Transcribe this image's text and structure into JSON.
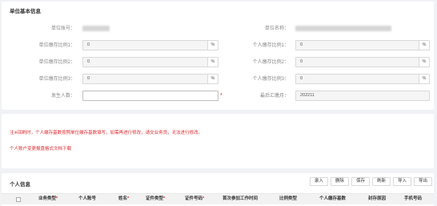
{
  "basic": {
    "title": "单位基本信息",
    "unit_no_label": "单位账号：",
    "unit_name_label": "单位名称：",
    "rows": [
      {
        "left_label": "单位缴存比例1：",
        "left_value": "0",
        "right_label": "个人缴存比例1：",
        "right_value": "0",
        "unit": "%"
      },
      {
        "left_label": "单位缴存比例2：",
        "left_value": "0",
        "right_label": "个人缴存比例2：",
        "right_value": "0",
        "unit": "%"
      },
      {
        "left_label": "单位缴存比例3：",
        "left_value": "0",
        "right_label": "个人缴存比例3：",
        "right_value": "0",
        "unit": "%"
      }
    ],
    "headcount_label": "发生人数：",
    "headcount_value": "",
    "required_mark": "*",
    "last_remit_label": "最后汇缴月：",
    "last_remit_value": "202211"
  },
  "notice": {
    "line1": "注※回刷时，个人缴存基数按照单位缴存基数填写，如需再进行修改，请交业务员，无法进行修改。",
    "line2": "个人账户变更报盘格式文档下载"
  },
  "personal": {
    "title": "个人信息",
    "buttons": [
      "录入",
      "删除",
      "保存",
      "刷新",
      "导入",
      "导出"
    ],
    "columns": [
      {
        "label": "业务类型",
        "required": true
      },
      {
        "label": "个人账号",
        "required": false
      },
      {
        "label": "姓名",
        "required": true
      },
      {
        "label": "证件类型",
        "required": true
      },
      {
        "label": "证件号码",
        "required": true
      },
      {
        "label": "首次参加工作时间",
        "required": false
      },
      {
        "label": "比例类型",
        "required": false
      },
      {
        "label": "个人缴存基数",
        "required": false
      },
      {
        "label": "封存原因",
        "required": false
      },
      {
        "label": "手机号码",
        "required": false
      }
    ],
    "required_mark": "*"
  }
}
